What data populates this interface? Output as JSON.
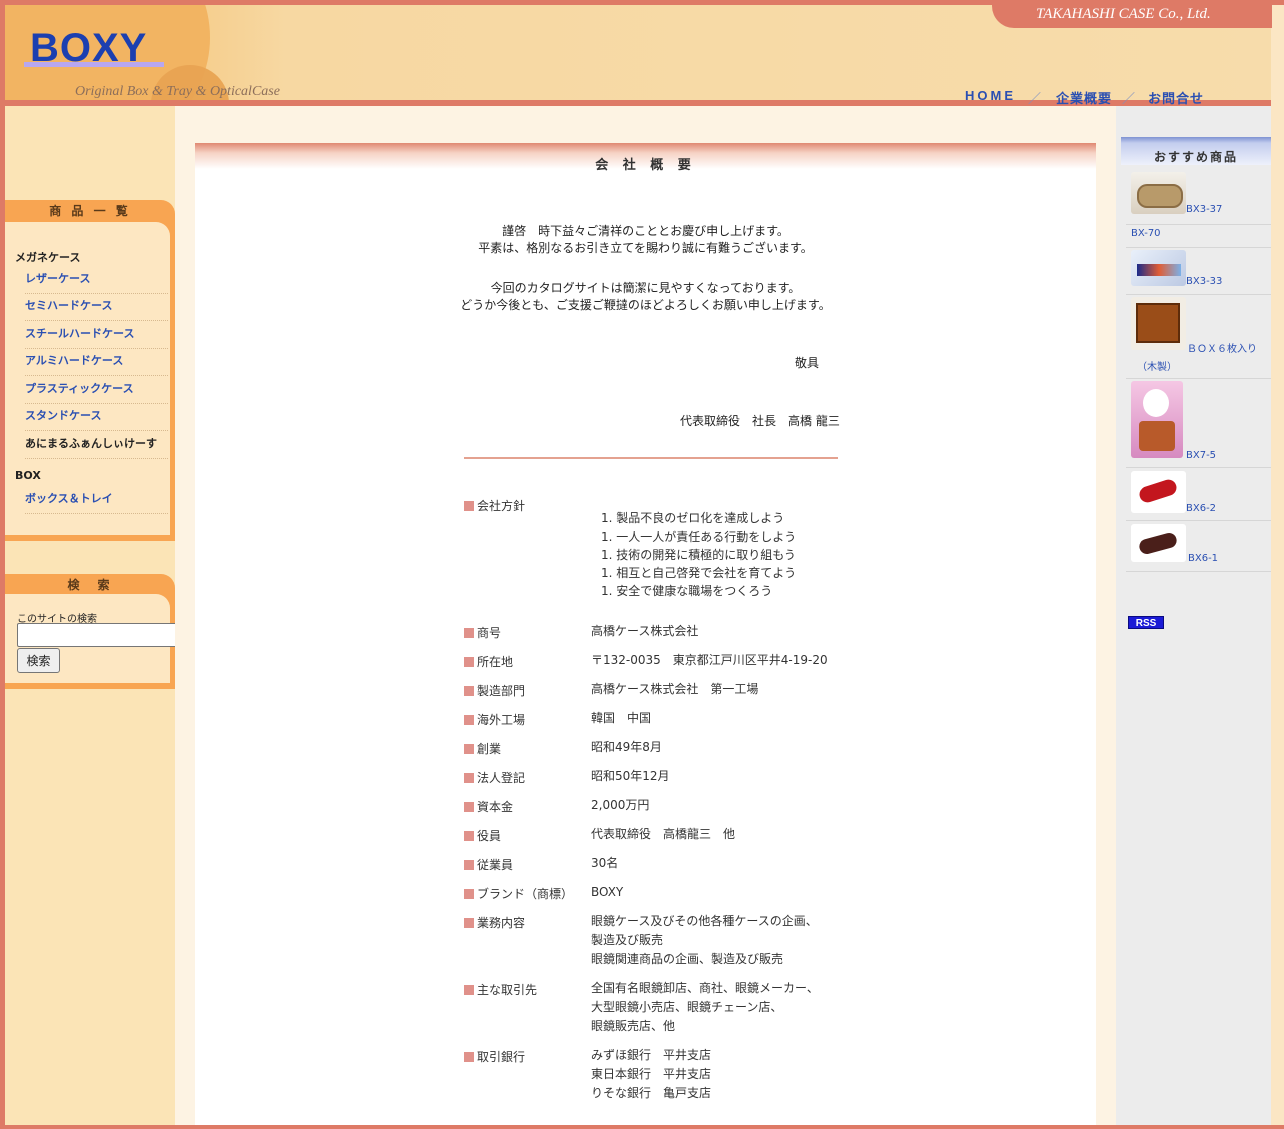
{
  "header": {
    "logo": "BOXY",
    "tagline": "Original Box & Tray & OpticalCase",
    "company_name": "TAKAHASHI CASE Co., Ltd.",
    "nav": {
      "home": "HOME",
      "company": "企業概要",
      "contact": "お問合せ",
      "separator": "／"
    }
  },
  "sidebar": {
    "products_title": "商 品 一 覧",
    "category_glasses": "メガネケース",
    "glasses_items": [
      "レザーケース",
      "セミハードケース",
      "スチールハードケース",
      "アルミハードケース",
      "プラスティックケース",
      "スタンドケース",
      "あにまるふぁんしぃけーす"
    ],
    "category_box": "BOX",
    "box_items": [
      "ボックス＆トレイ"
    ],
    "search_title": "検　索",
    "search_label": "このサイトの検索",
    "search_value": "",
    "search_button": "検索"
  },
  "main": {
    "title": "会 社 概 要",
    "greeting": [
      "謹啓　時下益々ご清祥のこととお慶び申し上げます。",
      "平素は、格別なるお引き立てを賜わり誠に有難うございます。",
      "今回のカタログサイトは簡潔に見やすくなっております。",
      "どうか今後とも、ご支援ご鞭撻のほどよろしくお願い申し上げます。"
    ],
    "closing": "敬具",
    "signature": "代表取締役　社長　高橋 龍三",
    "policy_label": "会社方針",
    "policy": [
      "1. 製品不良のゼロ化を達成しよう",
      "1. 一人一人が責任ある行動をしよう",
      "1. 技術の開発に積極的に取り組もう",
      "1. 相互と自己啓発で会社を育てよう",
      "1. 安全で健康な職場をつくろう"
    ],
    "info": [
      {
        "label": "商号",
        "value": [
          "高橋ケース株式会社"
        ]
      },
      {
        "label": "所在地",
        "value": [
          "〒132-0035　東京都江戸川区平井4-19-20"
        ]
      },
      {
        "label": "製造部門",
        "value": [
          "高橋ケース株式会社　第一工場"
        ]
      },
      {
        "label": "海外工場",
        "value": [
          "韓国　中国"
        ]
      },
      {
        "label": "創業",
        "value": [
          "昭和49年8月"
        ]
      },
      {
        "label": "法人登記",
        "value": [
          "昭和50年12月"
        ]
      },
      {
        "label": "資本金",
        "value": [
          "2,000万円"
        ]
      },
      {
        "label": "役員",
        "value": [
          "代表取締役　高橋龍三　他"
        ]
      },
      {
        "label": "従業員",
        "value": [
          "30名"
        ]
      },
      {
        "label": "ブランド（商標）",
        "value": [
          "BOXY"
        ]
      },
      {
        "label": "業務内容",
        "value": [
          "眼鏡ケース及びその他各種ケースの企画、",
          "製造及び販売",
          "眼鏡関連商品の企画、製造及び販売"
        ]
      },
      {
        "label": "主な取引先",
        "value": [
          "全国有名眼鏡卸店、商社、眼鏡メーカー、",
          "大型眼鏡小売店、眼鏡チェーン店、",
          "眼鏡販売店、他"
        ]
      },
      {
        "label": "取引銀行",
        "value": [
          "みずほ銀行　平井支店",
          "東日本銀行　平井支店",
          "りそな銀行　亀戸支店"
        ]
      }
    ]
  },
  "recommend": {
    "title": "おすすめ商品",
    "items": [
      "BX3-37",
      "BX-70",
      "BX3-33",
      "ＢＯＸ６枚入り（木製）",
      "BX7-5",
      "BX6-2",
      "BX6-1"
    ],
    "rss": "RSS"
  },
  "colors": {
    "frame": "#de7a66",
    "accent_blue": "#2a4fb2",
    "sidebar_orange": "#f8a552"
  }
}
